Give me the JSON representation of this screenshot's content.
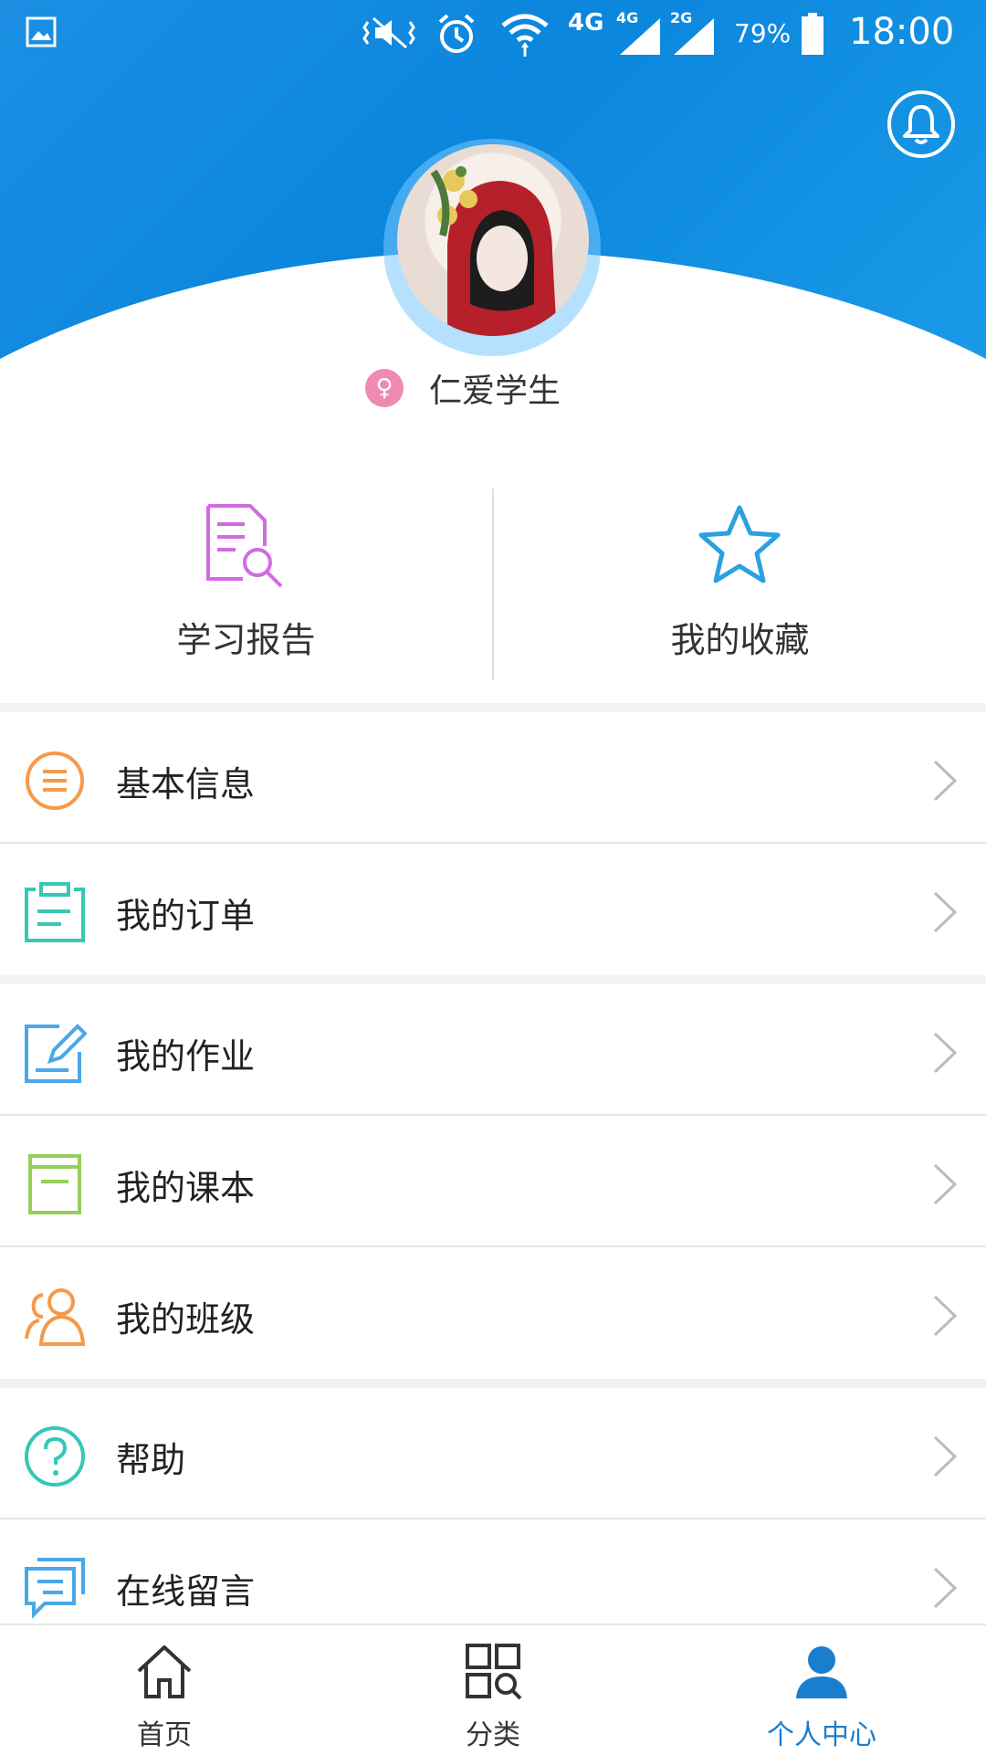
{
  "status_bar": {
    "network_4g": "4G",
    "signal1_label": "4G",
    "signal2_label": "2G",
    "battery": "79%",
    "time": "18:00"
  },
  "profile": {
    "username": "仁爱学生",
    "gender_badge": "♀"
  },
  "quick_actions": [
    {
      "label": "学习报告",
      "icon": "report-search-icon",
      "color": "#d36be3"
    },
    {
      "label": "我的收藏",
      "icon": "star-icon",
      "color": "#2aa1e0"
    }
  ],
  "menu_groups": [
    [
      {
        "label": "基本信息",
        "icon": "list-circle-icon",
        "color": "#f59a4a"
      },
      {
        "label": "我的订单",
        "icon": "clipboard-icon",
        "color": "#36c7b6"
      }
    ],
    [
      {
        "label": "我的作业",
        "icon": "edit-note-icon",
        "color": "#49a8e8"
      },
      {
        "label": "我的课本",
        "icon": "book-icon",
        "color": "#96cf5a"
      },
      {
        "label": "我的班级",
        "icon": "people-icon",
        "color": "#f59a4a"
      }
    ],
    [
      {
        "label": "帮助",
        "icon": "help-circle-icon",
        "color": "#36c7b6"
      },
      {
        "label": "在线留言",
        "icon": "message-icon",
        "color": "#49a8e8"
      }
    ]
  ],
  "tabbar": {
    "items": [
      {
        "label": "首页",
        "icon": "home-icon",
        "active": false
      },
      {
        "label": "分类",
        "icon": "category-icon",
        "active": false
      },
      {
        "label": "个人中心",
        "icon": "user-icon",
        "active": true
      }
    ],
    "active_color": "#1a7ecf"
  },
  "colors": {
    "header_blue": "#0b86dd"
  }
}
